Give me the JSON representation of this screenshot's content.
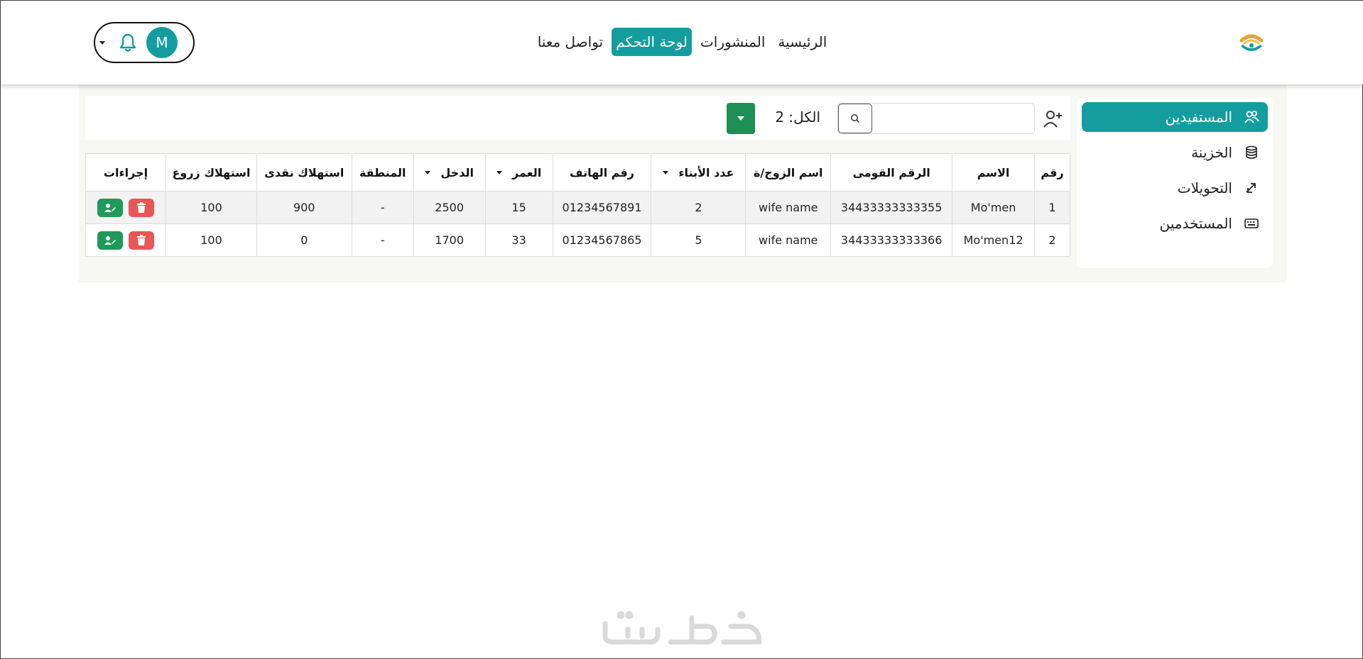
{
  "nav": {
    "links": [
      "الرئيسية",
      "المنشورات",
      "لوحة التحكم",
      "تواصل معنا"
    ],
    "active_index": 2
  },
  "user": {
    "avatar_initial": "M"
  },
  "sidebar": {
    "items": [
      {
        "label": "المستفيدين",
        "icon": "users-icon"
      },
      {
        "label": "الخزينة",
        "icon": "coins-icon"
      },
      {
        "label": "التحويلات",
        "icon": "transfer-icon"
      },
      {
        "label": "المستخدمين",
        "icon": "keyboard-icon"
      }
    ],
    "active_index": 0
  },
  "toolbar": {
    "search_value": "",
    "total_label": "الكل: 2"
  },
  "table": {
    "headers": [
      "رقم",
      "الاسم",
      "الرقم القومى",
      "اسم الزوج/ة",
      "عدد الأبناء",
      "رقم الهاتف",
      "العمر",
      "الدخل",
      "المنطقة",
      "استهلاك نقدى",
      "استهلاك زروع",
      "إجراءات"
    ],
    "rows": [
      [
        "1",
        "Mo'men",
        "34433333333355",
        "wife name",
        "2",
        "01234567891",
        "15",
        "2500",
        "-",
        "900",
        "100"
      ],
      [
        "2",
        "Mo'men12",
        "34433333333366",
        "wife name",
        "5",
        "01234567865",
        "33",
        "1700",
        "-",
        "0",
        "100"
      ]
    ]
  },
  "colors": {
    "accent": "#139d9f",
    "green": "#1e8f55",
    "danger": "#e95656"
  },
  "watermark": {
    "text": "خمسات"
  }
}
